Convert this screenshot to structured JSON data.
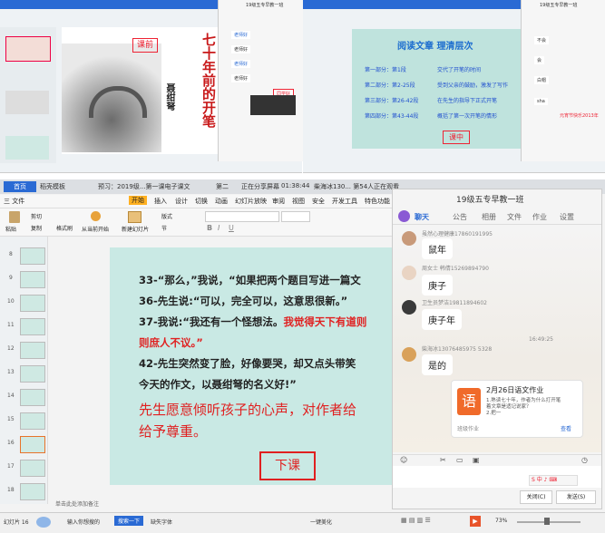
{
  "top_left": {
    "slide_label": "课前",
    "vertical_title": "七十年前的开笔",
    "author": "聂绀弩",
    "chat_title": "19级五专早教一班",
    "chat_bubbles": [
      "老师好",
      "老师好",
      "老师好",
      "老师好",
      "老师好"
    ],
    "chat_highlight": "同学好"
  },
  "top_right": {
    "slide_title": "阅读文章 理清层次",
    "rows": [
      {
        "part": "第一部分：第1段",
        "desc": "交代了开笔的时间"
      },
      {
        "part": "第二部分：第2-25段",
        "desc": "受到父亲的鼓励，激发了写作"
      },
      {
        "part": "第三部分：第26-42段",
        "desc": "在先生的指导下正式开笔"
      },
      {
        "part": "第四部分：第43-44段",
        "desc": "概括了第一次开笔的情形"
      }
    ],
    "slide_label": "课中",
    "chat_title": "19级五专早教一班",
    "chat_bubbles": [
      "不会",
      "会",
      "白帽",
      "sha"
    ],
    "chat_highlight": "元宵节快乐2013年"
  },
  "window": {
    "tabs": [
      "首页",
      "稻壳模板",
      "预习：2019级...第一课电子课文",
      "第二"
    ],
    "sharing_status": "正在分享屏幕",
    "timer": "01:38:44",
    "speaker": "柴海冰130...  第54人正在观看"
  },
  "ribbon": {
    "menus": [
      "三 文件",
      "开始",
      "插入",
      "设计",
      "切换",
      "动画",
      "幻灯片放映",
      "审阅",
      "视图",
      "安全",
      "开发工具",
      "特色功能"
    ],
    "active_menu": "开始",
    "tools": [
      "剪切",
      "复制",
      "格式刷",
      "粘贴",
      "从当前开始",
      "新建幻灯片",
      "版式",
      "节"
    ]
  },
  "slide": {
    "lines": [
      "33-“那么，”我说，“如果把两个题目写进一篇文",
      "36-先生说:“可以，完全可以，这意思很新。”",
      "37-我说:“我还有一个怪想法。"
    ],
    "line3_red": "我觉得天下有道则",
    "line4_red": "则庶人不议。”",
    "lines_after": [
      "42-先生突然变了脸，好像要哭，却又点头带笑",
      "今天的作文，以聂绀弩的名义好!”"
    ],
    "summary_line1": "先生愿意倾听孩子的心声，对作者给",
    "summary_line2": "给予尊重。",
    "label": "下课"
  },
  "thumbnails": [
    "8",
    "9",
    "10",
    "11",
    "12",
    "13",
    "14",
    "15",
    "16",
    "17",
    "18"
  ],
  "notes_placeholder": "单击此处添加备注",
  "chat": {
    "title": "19级五专早教一班",
    "tabs": [
      "聊天",
      "公告",
      "相册",
      "文件",
      "作业",
      "设置"
    ],
    "messages": [
      {
        "sender": "虽然心理健康17860191995",
        "text": "鼠年"
      },
      {
        "sender": "周女士 韩倩15269894790",
        "text": "庚子"
      },
      {
        "sender": "卫生员梦洁19811894602",
        "text": "庚子年"
      },
      {
        "sender": "柴海冰13076485975 5328",
        "text": "是的"
      }
    ],
    "time": "16:49:25",
    "card_title": "2月26日语文作业",
    "card_lines": [
      "1.熟读七十年，作者为什么打开笔",
      "着文章是适记说家？",
      "2.把一"
    ],
    "card_icon": "语",
    "card_footer": "班级作业",
    "card_link": "查看",
    "close_button": "关闭(C)",
    "send_button": "发送(S)"
  },
  "taskbar": {
    "items": [
      "幻灯片 16",
      "输入你想搜的",
      "搜索一下",
      "缺失字体",
      "一键美化"
    ],
    "zoom": "73%"
  }
}
